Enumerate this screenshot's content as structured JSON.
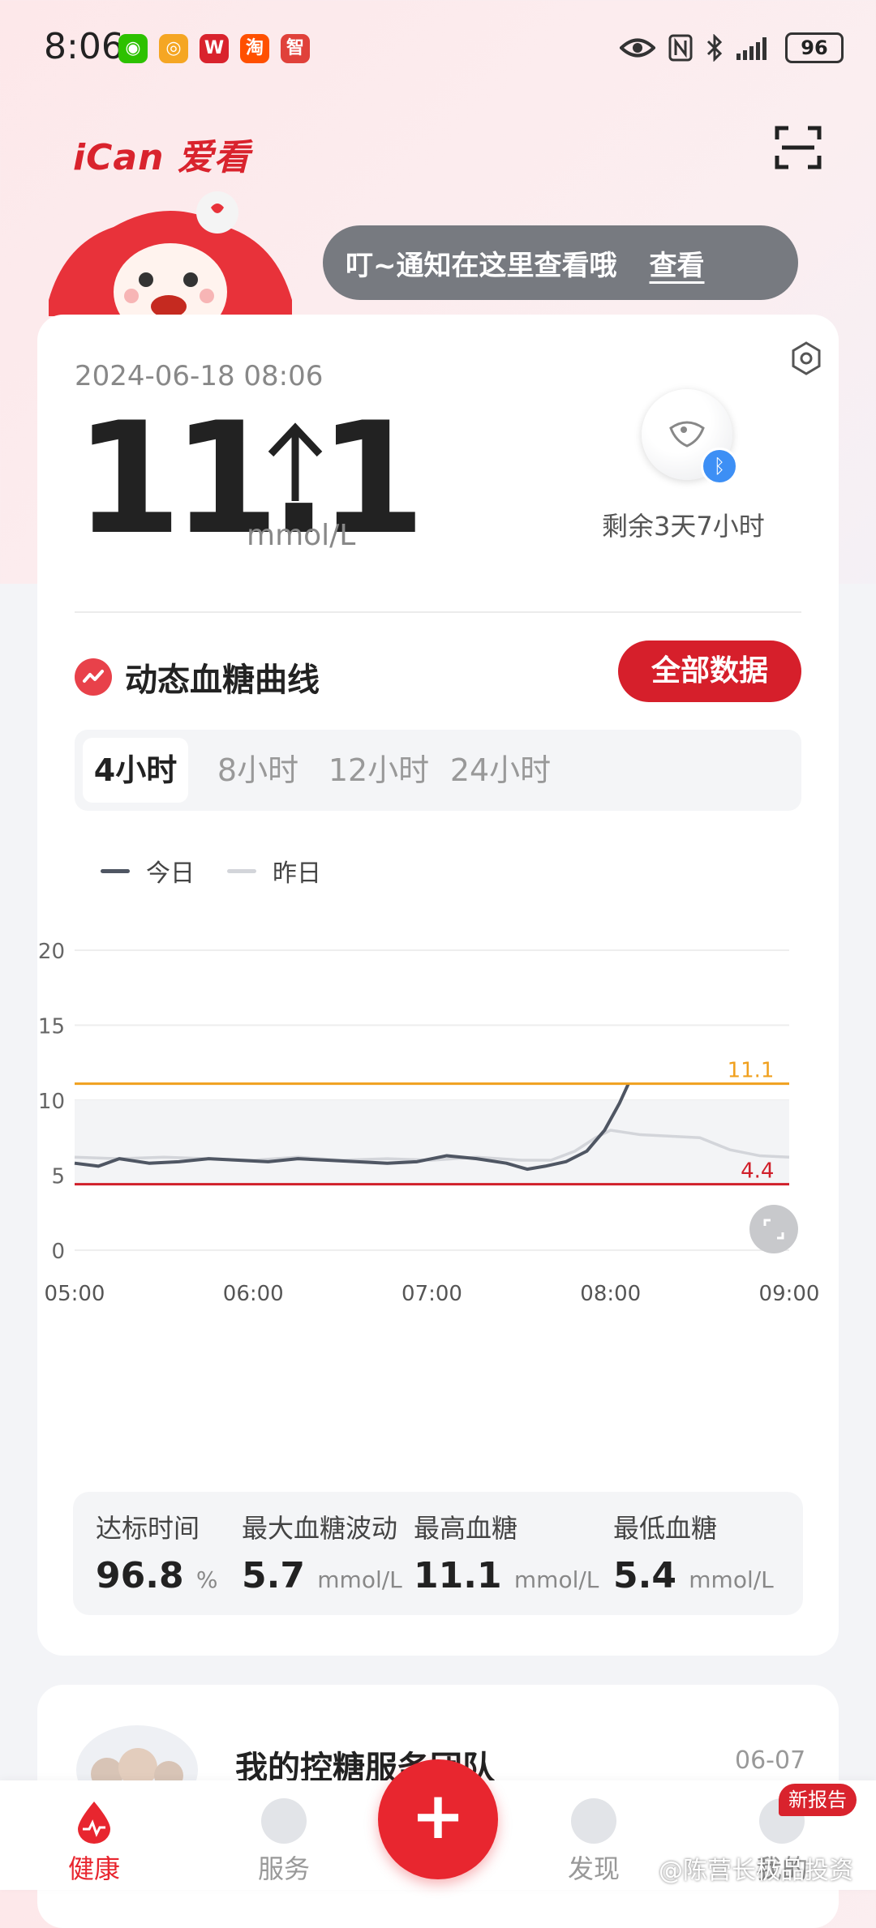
{
  "status_bar": {
    "time": "8:06",
    "battery": "96"
  },
  "header": {
    "logo_text": "iCan 爱看"
  },
  "notice": {
    "message": "叮~通知在这里查看哦",
    "view_label": "查看"
  },
  "reading": {
    "datetime": "2024-06-18 08:06",
    "value": "11.1",
    "trend": "rising",
    "unit": "mmol/L",
    "sensor_remaining": "剩余3天7小时"
  },
  "section": {
    "title": "动态血糖曲线",
    "all_data_button": "全部数据"
  },
  "tabs": [
    {
      "label": "4小时",
      "active": true
    },
    {
      "label": "8小时",
      "active": false
    },
    {
      "label": "12小时",
      "active": false
    },
    {
      "label": "24小时",
      "active": false
    }
  ],
  "legend": {
    "today": "今日",
    "yesterday": "昨日"
  },
  "chart_data": {
    "type": "line",
    "x_ticks": [
      "05:00",
      "06:00",
      "07:00",
      "08:00",
      "09:00"
    ],
    "y_ticks": [
      "0",
      "5",
      "10",
      "15",
      "20"
    ],
    "ylim": [
      0,
      20
    ],
    "xlim": [
      "05:00",
      "09:00"
    ],
    "high_threshold": 11.1,
    "high_label": "11.1",
    "low_threshold": 4.4,
    "low_label": "4.4",
    "target_band": [
      4.4,
      10
    ],
    "grid": true,
    "series": [
      {
        "name": "今日",
        "color": "#4f5663",
        "x": [
          "05:00",
          "05:08",
          "05:15",
          "05:25",
          "05:35",
          "05:45",
          "05:55",
          "06:05",
          "06:15",
          "06:25",
          "06:35",
          "06:45",
          "06:55",
          "07:05",
          "07:15",
          "07:25",
          "07:32",
          "07:38",
          "07:45",
          "07:52",
          "07:58",
          "08:03",
          "08:06"
        ],
        "y": [
          5.8,
          5.6,
          6.1,
          5.8,
          5.9,
          6.1,
          6.0,
          5.9,
          6.1,
          6.0,
          5.9,
          5.8,
          5.9,
          6.3,
          6.1,
          5.8,
          5.4,
          5.6,
          5.9,
          6.6,
          8.0,
          9.8,
          11.1
        ]
      },
      {
        "name": "昨日",
        "color": "#d3d5da",
        "x": [
          "05:00",
          "05:15",
          "05:30",
          "05:45",
          "06:00",
          "06:15",
          "06:30",
          "06:45",
          "07:00",
          "07:15",
          "07:30",
          "07:40",
          "07:48",
          "07:55",
          "08:00",
          "08:10",
          "08:20",
          "08:30",
          "08:40",
          "08:50",
          "09:00"
        ],
        "y": [
          6.2,
          6.1,
          6.2,
          6.1,
          6.0,
          6.2,
          6.0,
          6.1,
          6.0,
          6.2,
          6.0,
          6.0,
          6.6,
          7.5,
          8.0,
          7.7,
          7.6,
          7.5,
          6.7,
          6.3,
          6.2
        ]
      }
    ]
  },
  "stats": [
    {
      "label": "达标时间",
      "value": "96.8",
      "unit": "%"
    },
    {
      "label": "最大血糖波动",
      "value": "5.7",
      "unit": "mmol/L"
    },
    {
      "label": "最高血糖",
      "value": "11.1",
      "unit": "mmol/L"
    },
    {
      "label": "最低血糖",
      "value": "5.4",
      "unit": "mmol/L"
    }
  ],
  "team_card": {
    "title": "我的控糖服务团队",
    "date": "06-07"
  },
  "nav": {
    "health": "健康",
    "service": "服务",
    "add": "+",
    "discover": "发现",
    "mine": "我的",
    "new_report_badge": "新报告"
  },
  "watermark": "@陈营长极品投资",
  "colors": {
    "brand_red": "#d61f2b",
    "high_line": "#f0a01e",
    "low_line": "#d01f2a"
  }
}
